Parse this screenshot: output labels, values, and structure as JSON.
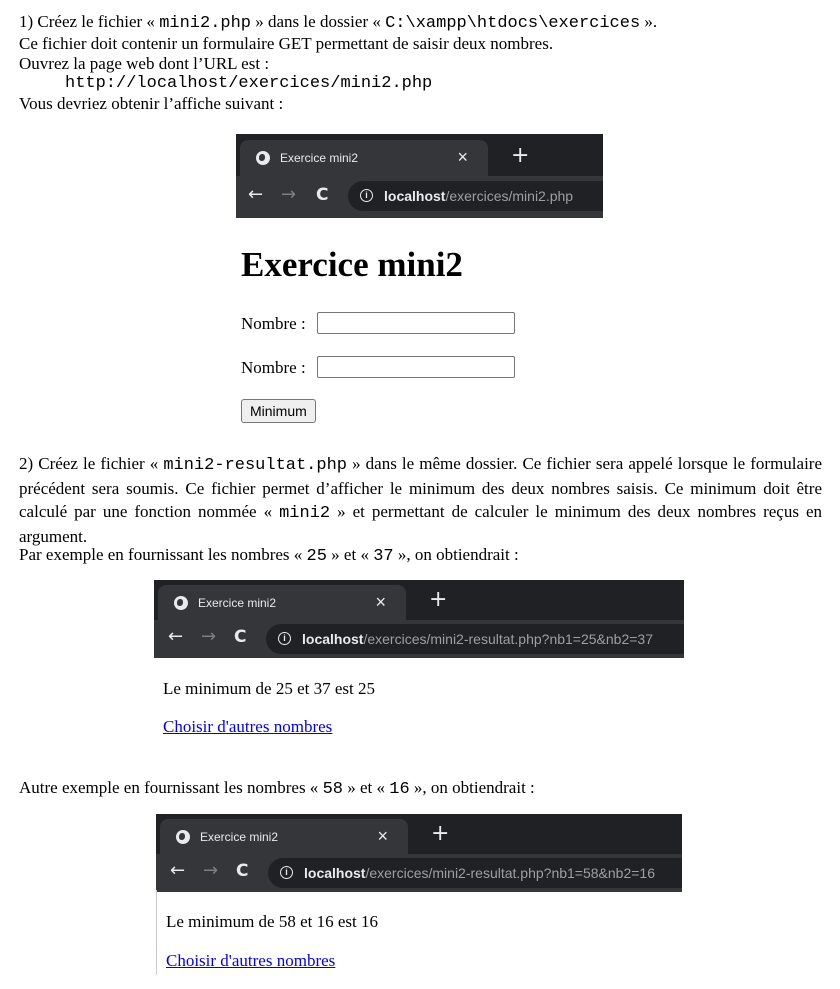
{
  "step1": {
    "line1_a": "1) Créez le fichier « ",
    "line1_file": "mini2.php",
    "line1_b": " » dans le dossier « ",
    "line1_path": "C:\\xampp\\htdocs\\exercices",
    "line1_c": " ».",
    "line2": "Ce fichier doit contenir un formulaire GET permettant de saisir deux nombres.",
    "line3": "Ouvrez la page web dont l’URL est :",
    "url": "http://localhost/exercices/mini2.php",
    "line4": "Vous devriez obtenir l’affiche suivant :"
  },
  "browser1": {
    "tab_title": "Exercice mini2",
    "close": "×",
    "newtab": "+",
    "back": "←",
    "forward": "→",
    "reload": "C",
    "info": "i",
    "host": "localhost",
    "path": "/exercices/mini2.php"
  },
  "form": {
    "heading": "Exercice mini2",
    "label1": "Nombre :",
    "value1": "",
    "label2": "Nombre :",
    "value2": "",
    "button": "Minimum"
  },
  "step2": {
    "a": "2) Créez le fichier « ",
    "file": "mini2-resultat.php",
    "b": " » dans le même dossier. Ce fichier sera appelé lorsque le formulaire précédent sera soumis. Ce fichier permet d’afficher le minimum des deux nombres saisis. Ce minimum doit être calculé par une fonction nommée « ",
    "func": "mini2",
    "c": " » et permettant de calculer le minimum des deux nombres reçus en argument.",
    "ex_a": "Par exemple en fournissant les nombres « ",
    "ex_n1": "25",
    "ex_b": " » et « ",
    "ex_n2": "37",
    "ex_c": " », on obtiendrait :"
  },
  "browser2": {
    "tab_title": "Exercice mini2",
    "close": "×",
    "newtab": "+",
    "back": "←",
    "forward": "→",
    "reload": "C",
    "info": "i",
    "host": "localhost",
    "path": "/exercices/mini2-resultat.php?nb1=25&nb2=37"
  },
  "result1": {
    "text": "Le minimum de 25 et 37 est 25",
    "link": "Choisir d'autres nombres"
  },
  "step3": {
    "a": "Autre exemple en fournissant les nombres « ",
    "n1": "58",
    "b": " » et « ",
    "n2": "16",
    "c": " », on obtiendrait :"
  },
  "browser3": {
    "tab_title": "Exercice mini2",
    "close": "×",
    "newtab": "+",
    "back": "←",
    "forward": "→",
    "reload": "C",
    "info": "i",
    "host": "localhost",
    "path": "/exercices/mini2-resultat.php?nb1=58&nb2=16"
  },
  "result2": {
    "text": "Le minimum de 58 et 16 est 16",
    "link": "Choisir d'autres nombres"
  }
}
